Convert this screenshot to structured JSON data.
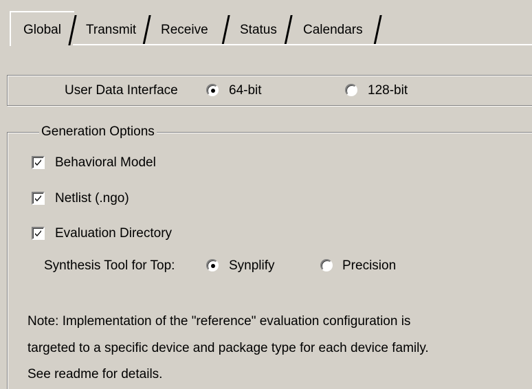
{
  "tabs": [
    {
      "label": "Global",
      "selected": true
    },
    {
      "label": "Transmit",
      "selected": false
    },
    {
      "label": "Receive",
      "selected": false
    },
    {
      "label": "Status",
      "selected": false
    },
    {
      "label": "Calendars",
      "selected": false
    }
  ],
  "user_data_interface": {
    "label": "User Data Interface",
    "options": [
      {
        "label": "64-bit",
        "selected": true
      },
      {
        "label": "128-bit",
        "selected": false
      }
    ]
  },
  "generation_options": {
    "title": "Generation Options",
    "checkboxes": [
      {
        "label": "Behavioral Model",
        "checked": true
      },
      {
        "label": "Netlist (.ngo)",
        "checked": true
      },
      {
        "label": "Evaluation Directory",
        "checked": true
      }
    ],
    "synthesis": {
      "label": "Synthesis Tool for Top:",
      "options": [
        {
          "label": "Synplify",
          "selected": true
        },
        {
          "label": "Precision",
          "selected": false
        }
      ]
    },
    "note_lines": [
      "Note:  Implementation of the \"reference\" evaluation configuration is",
      "targeted to a specific device and package type for each device family.",
      "See readme for details."
    ]
  }
}
